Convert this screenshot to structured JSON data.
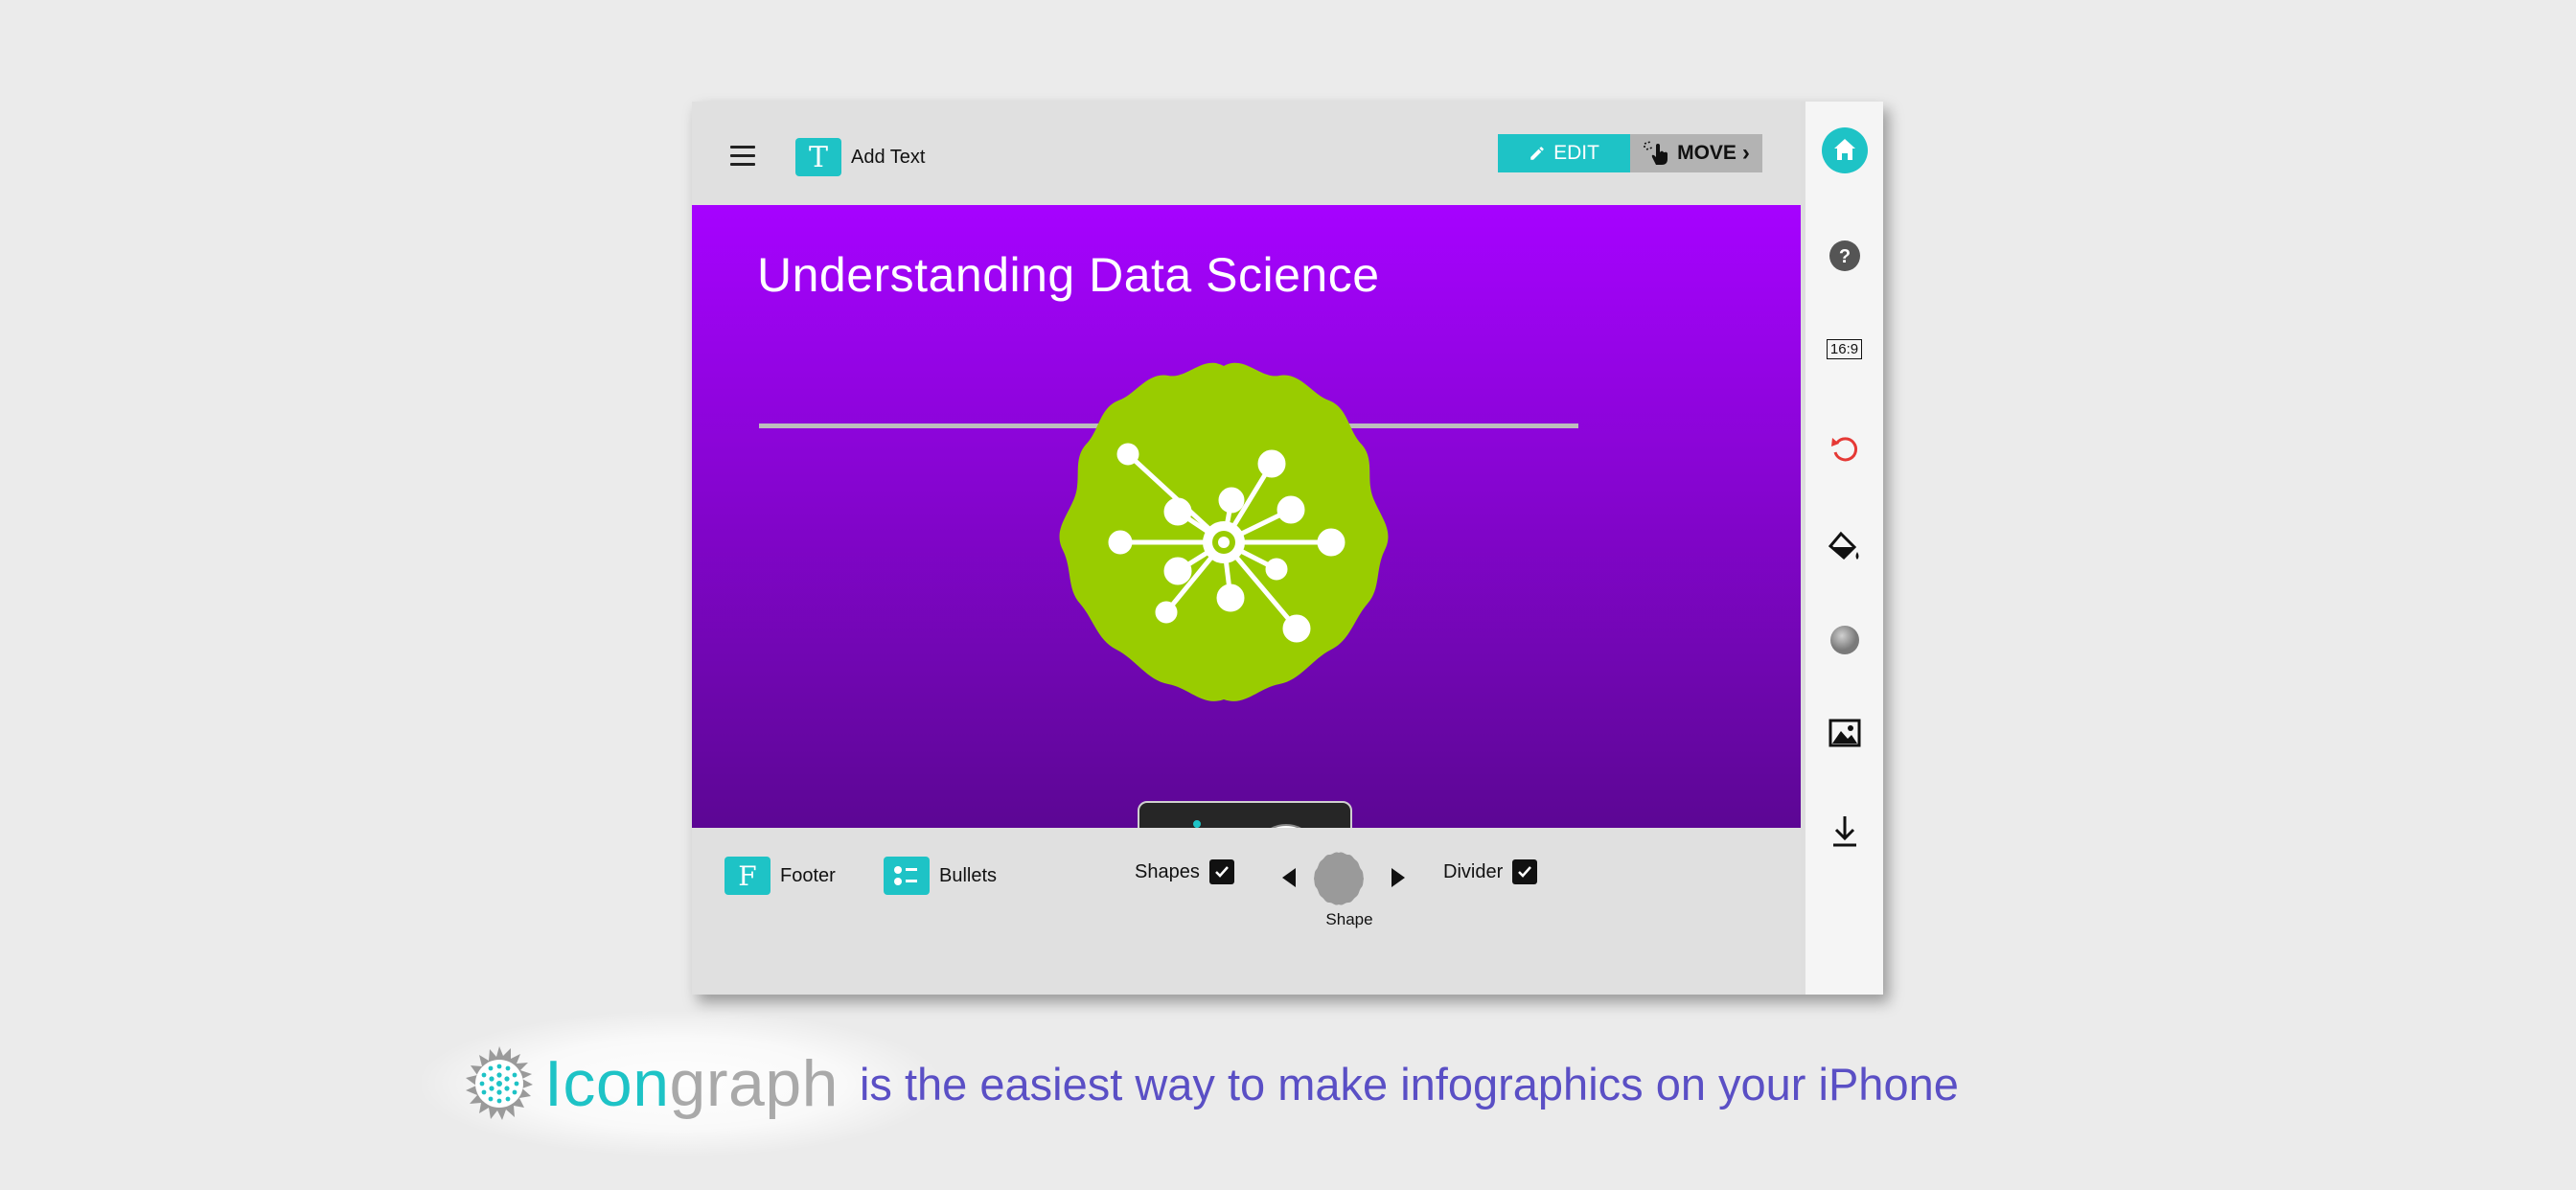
{
  "toolbar": {
    "menu_icon": "hamburger-icon",
    "add_text_icon_glyph": "T",
    "add_text_label": "Add Text",
    "edit_label": "EDIT",
    "move_label": "MOVE",
    "move_suffix": "›"
  },
  "slide": {
    "title": "Understanding Data Science",
    "background_top": "#a602ff",
    "background_bottom": "#5c0694",
    "shape_color": "#99cc00",
    "icon": "network-hub-icon"
  },
  "selector": {
    "options": [
      "network-icon",
      "circle-shape"
    ]
  },
  "bottom": {
    "footer_glyph": "F",
    "footer_label": "Footer",
    "bullets_label": "Bullets",
    "shapes_label": "Shapes",
    "shapes_checked": true,
    "shape_label": "Shape",
    "divider_label": "Divider",
    "divider_checked": true
  },
  "sidebar": {
    "items": [
      "home-icon",
      "help-icon",
      "aspect-ratio-icon",
      "undo-icon",
      "paint-bucket-icon",
      "color-swatch-icon",
      "image-icon",
      "download-icon"
    ],
    "aspect_ratio": "16:9"
  },
  "tagline": {
    "brand_part1": "Icon",
    "brand_part2": "graph",
    "slogan": "is the easiest way to make infographics on your iPhone"
  },
  "colors": {
    "accent": "#1ec3c6",
    "slogan": "#5a4fc5",
    "undo": "#e53935"
  }
}
